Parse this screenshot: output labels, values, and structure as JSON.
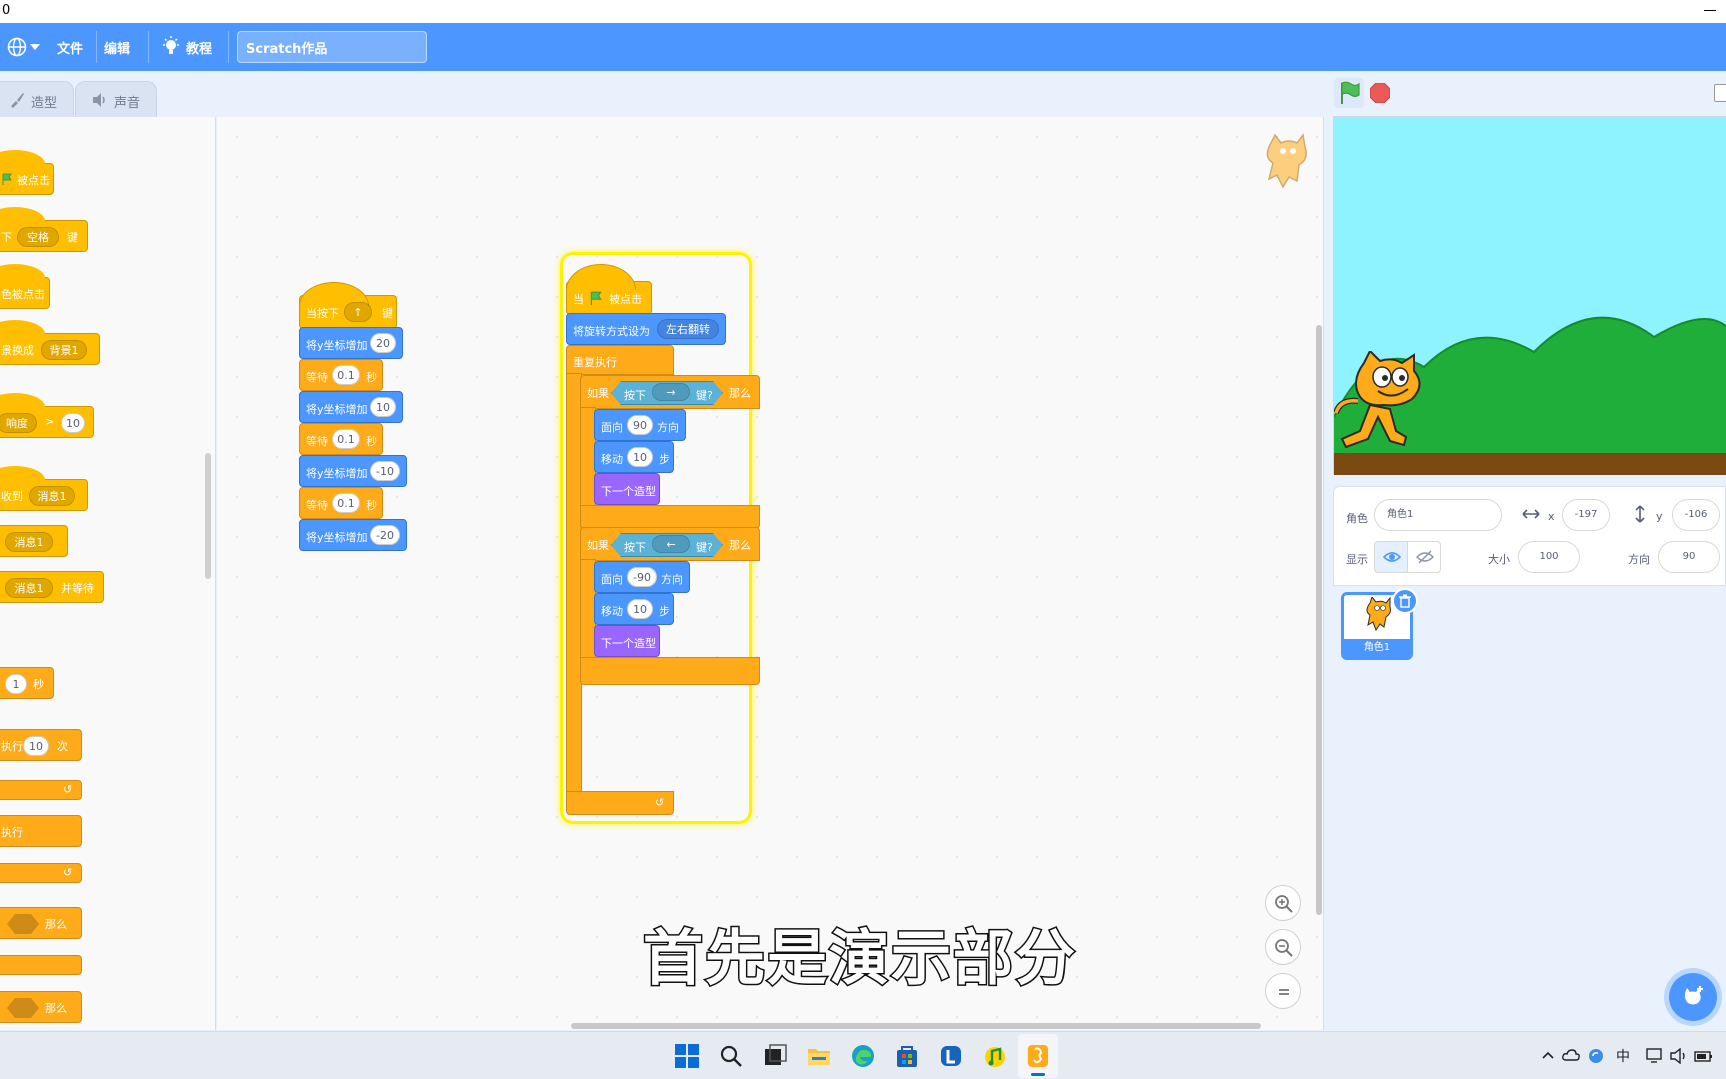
{
  "window": {
    "title_fragment": "0"
  },
  "menubar": {
    "file": "文件",
    "edit": "编辑",
    "tutorials": "教程",
    "project_title": "Scratch作品"
  },
  "tabs": {
    "costumes": "造型",
    "sounds": "声音"
  },
  "palette": {
    "when_flag_clicked": "被点击",
    "when_key_prefix": "下",
    "when_key_value": "空格",
    "when_key_suffix": "键",
    "when_sprite_clicked": "色被点击",
    "when_backdrop_switches": "景换成",
    "backdrop_value": "背景1",
    "when_greater_left": "响度",
    "when_greater_op": ">",
    "when_greater_value": "10",
    "when_receive": "收到",
    "message_value": "消息1",
    "broadcast_value": "消息1",
    "broadcast_wait_value": "消息1",
    "broadcast_wait_suffix": "并等待",
    "wait_value": "1",
    "wait_suffix": "秒",
    "repeat_prefix": "执行",
    "repeat_value": "10",
    "repeat_suffix": "次",
    "forever": "执行",
    "if_then": "那么",
    "if_else_then": "那么"
  },
  "script_left": {
    "hat_prefix": "当按下",
    "hat_key": "↑",
    "hat_suffix": "键",
    "change_y_label": "将y坐标增加",
    "wait_label": "等待",
    "seconds": "秒",
    "values": [
      "20",
      "0.1",
      "10",
      "0.1",
      "-10",
      "0.1",
      "-20"
    ]
  },
  "script_right": {
    "hat_when": "当",
    "hat_clicked": "被点击",
    "rotation_label": "将旋转方式设为",
    "rotation_value": "左右翻转",
    "forever": "重复执行",
    "if_label": "如果",
    "then_label": "那么",
    "key_pressed_prefix": "按下",
    "key_pressed_suffix": "键?",
    "key1": "→",
    "key2": "←",
    "point_label": "面向",
    "direction_label": "方向",
    "move_label": "移动",
    "steps_label": "步",
    "next_costume": "下一个造型",
    "dir1": "90",
    "move1": "10",
    "dir2": "-90",
    "move2": "10"
  },
  "subtitle": "首先是演示部分",
  "sprite_info": {
    "sprite_label": "角色",
    "sprite_name": "角色1",
    "x_label": "x",
    "x_value": "-197",
    "y_label": "y",
    "y_value": "-106",
    "show_label": "显示",
    "size_label": "大小",
    "size_value": "100",
    "direction_label": "方向",
    "direction_value": "90"
  },
  "sprite_list": [
    {
      "name": "角色1"
    }
  ],
  "taskbar": {
    "tray_lang": "中"
  },
  "colors": {
    "menubar": "#4c97ff",
    "motion": "#4c97ff",
    "events": "#ffbf00",
    "control": "#ffab19",
    "looks": "#9966ff",
    "sensing": "#5cb1d6",
    "stage_sky": "#8ef3ff",
    "grass": "#1fae3a",
    "ground": "#7a4a12"
  },
  "icons": [
    "globe-icon",
    "bulb-icon",
    "brush-icon",
    "speaker-icon",
    "green-flag-icon",
    "stop-icon",
    "zoom-in-icon",
    "zoom-out-icon",
    "zoom-reset-icon",
    "eye-icon",
    "eye-off-icon",
    "trash-icon",
    "add-sprite-icon",
    "cat-icon"
  ]
}
